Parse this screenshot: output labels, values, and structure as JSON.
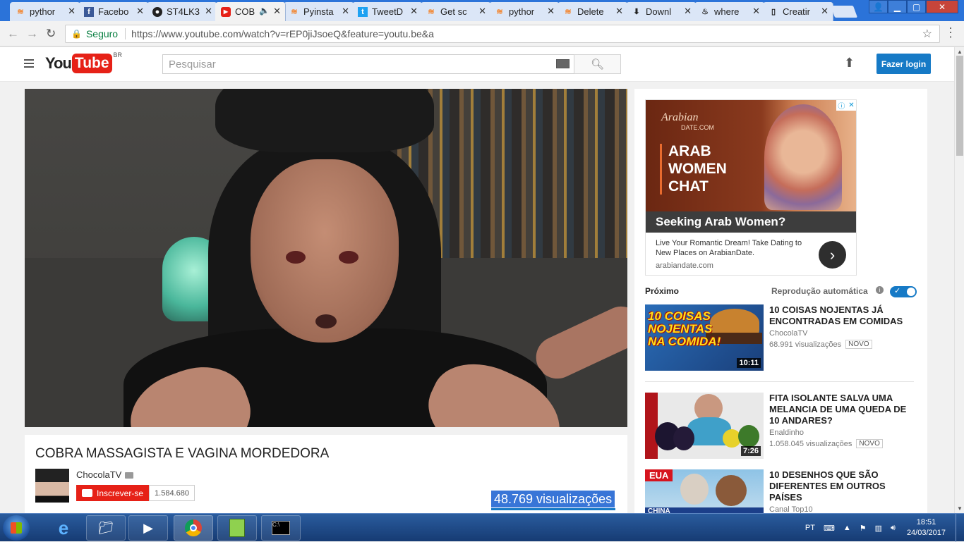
{
  "browser": {
    "tabs": [
      {
        "title": "pythor",
        "icon": "stackoverflow"
      },
      {
        "title": "Facebo",
        "icon": "facebook"
      },
      {
        "title": "ST4LK3",
        "icon": "github"
      },
      {
        "title": "COB",
        "icon": "youtube",
        "active": true
      },
      {
        "title": "Pyinsta",
        "icon": "stackoverflow"
      },
      {
        "title": "TweetD",
        "icon": "twitter"
      },
      {
        "title": "Get sc",
        "icon": "stackoverflow"
      },
      {
        "title": "pythor",
        "icon": "stackoverflow"
      },
      {
        "title": "Delete",
        "icon": "stackoverflow"
      },
      {
        "title": "Downl",
        "icon": "download"
      },
      {
        "title": "where",
        "icon": "fire"
      },
      {
        "title": "Creatir",
        "icon": "document"
      }
    ],
    "secure_label": "Seguro",
    "url": "https://www.youtube.com/watch?v=rEP0jiJsoeQ&feature=youtu.be&a"
  },
  "youtube": {
    "logo_you": "You",
    "logo_tube": "Tube",
    "region": "BR",
    "search_placeholder": "Pesquisar",
    "login_label": "Fazer login"
  },
  "video": {
    "title": "COBRA MASSAGISTA E VAGINA MORDEDORA",
    "channel": "ChocolaTV",
    "subscribe_label": "Inscrever-se",
    "subscriber_count": "1.584.680",
    "views": "48.769 visualizações"
  },
  "ad": {
    "brand": "Arabian",
    "brand_sub": "DATE.COM",
    "headline": "ARAB WOMEN CHAT",
    "title": "Seeking Arab Women?",
    "description": "Live Your Romantic Dream! Take Dating to New Places on ArabianDate.",
    "domain": "arabiandate.com"
  },
  "sidebar": {
    "next_label": "Próximo",
    "autoplay_label": "Reprodução automática",
    "videos": [
      {
        "title": "10 COISAS NOJENTAS JÁ ENCONTRADAS EM COMIDAS",
        "channel": "ChocolaTV",
        "views": "68.991 visualizações",
        "badge": "NOVO",
        "duration": "10:11",
        "thumb_text": "10 COISAS NOJENTAS NA COMIDA!"
      },
      {
        "title": "FITA ISOLANTE SALVA UMA MELANCIA DE UMA QUEDA DE 10 ANDARES?",
        "channel": "Enaldinho",
        "views": "1.058.045 visualizações",
        "badge": "NOVO",
        "duration": "7:26"
      },
      {
        "title": "10 DESENHOS QUE SÃO DIFERENTES EM OUTROS PAÍSES",
        "channel": "Canal Top10",
        "thumb_text": "EUA",
        "thumb_text2": "CHINA"
      }
    ]
  },
  "taskbar": {
    "language": "PT",
    "time": "18:51",
    "date": "24/03/2017"
  }
}
